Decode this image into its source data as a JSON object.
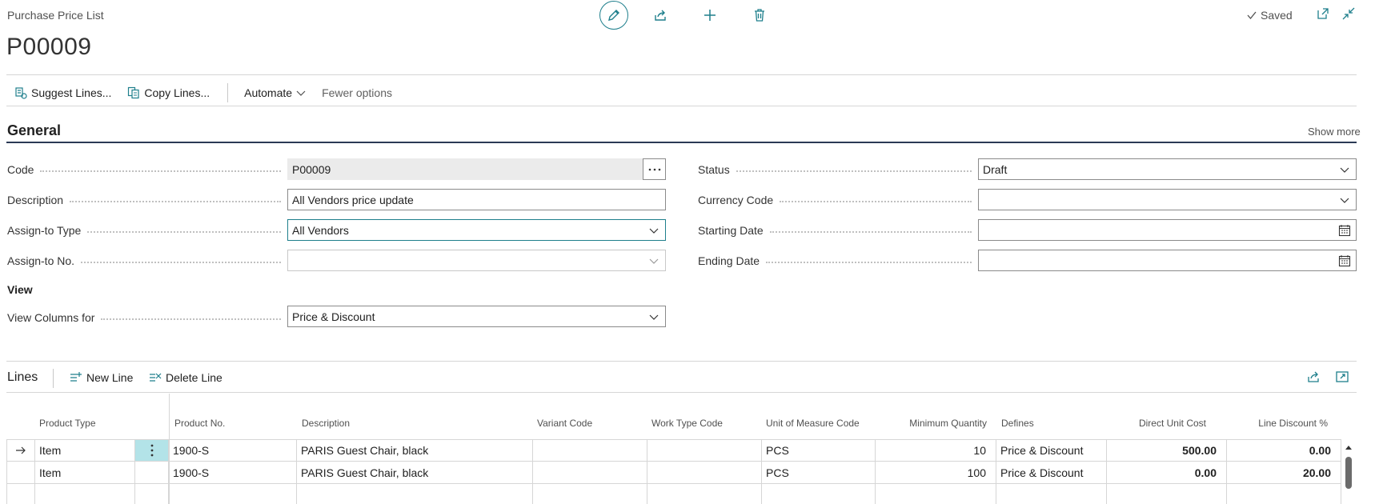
{
  "header": {
    "caption": "Purchase Price List",
    "record_no": "P00009",
    "saved_label": "Saved"
  },
  "actions": {
    "suggest_lines": "Suggest Lines...",
    "copy_lines": "Copy Lines...",
    "automate": "Automate",
    "fewer_options": "Fewer options"
  },
  "general": {
    "title": "General",
    "show_more": "Show more",
    "left_fields": [
      {
        "label": "Code",
        "value": "P00009"
      },
      {
        "label": "Description",
        "value": "All Vendors price update"
      },
      {
        "label": "Assign-to Type",
        "value": "All Vendors"
      },
      {
        "label": "Assign-to No.",
        "value": ""
      }
    ],
    "right_fields": [
      {
        "label": "Status",
        "value": "Draft"
      },
      {
        "label": "Currency Code",
        "value": ""
      },
      {
        "label": "Starting Date",
        "value": ""
      },
      {
        "label": "Ending Date",
        "value": ""
      }
    ],
    "view_heading": "View",
    "view_columns_label": "View Columns for",
    "view_columns_value": "Price & Discount"
  },
  "lines": {
    "title": "Lines",
    "new_line": "New Line",
    "delete_line": "Delete Line",
    "columns": [
      "Product Type",
      "Product No.",
      "Description",
      "Variant Code",
      "Work Type Code",
      "Unit of Measure Code",
      "Minimum Quantity",
      "Defines",
      "Direct Unit Cost",
      "Line Discount %"
    ],
    "rows": [
      {
        "product_type": "Item",
        "product_no": "1900-S",
        "description": "PARIS Guest Chair, black",
        "variant_code": "",
        "work_type_code": "",
        "uom": "PCS",
        "min_qty": "10",
        "defines": "Price & Discount",
        "direct_unit_cost": "500.00",
        "line_discount": "0.00"
      },
      {
        "product_type": "Item",
        "product_no": "1900-S",
        "description": "PARIS Guest Chair, black",
        "variant_code": "",
        "work_type_code": "",
        "uom": "PCS",
        "min_qty": "100",
        "defines": "Price & Discount",
        "direct_unit_cost": "0.00",
        "line_discount": "20.00"
      }
    ]
  },
  "colors": {
    "accent": "#1e7f8c",
    "selected_cell": "#b3e3e8",
    "section_rule": "#2b3a55"
  }
}
